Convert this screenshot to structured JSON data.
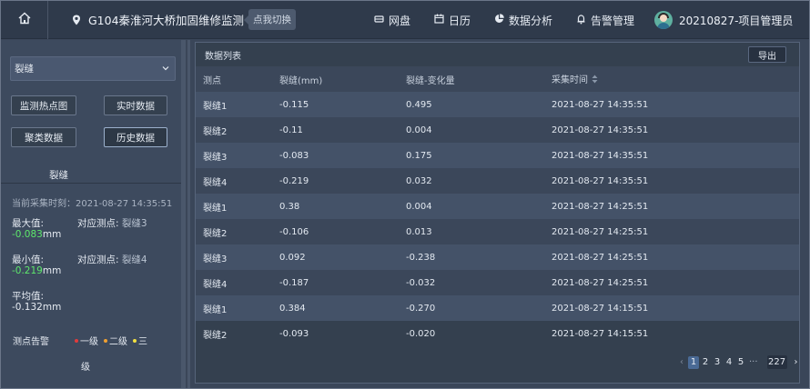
{
  "header": {
    "project_name": "G104秦淮河大桥加固维修监测",
    "switch_label": "点我切换",
    "nav": [
      {
        "label": "网盘",
        "icon": "cloud-drive-icon"
      },
      {
        "label": "日历",
        "icon": "calendar-icon"
      },
      {
        "label": "数据分析",
        "icon": "pie-chart-icon"
      },
      {
        "label": "告警管理",
        "icon": "bell-icon"
      }
    ],
    "user_name": "20210827-项目管理员"
  },
  "left": {
    "select_value": "裂缝",
    "buttons": {
      "heatmap": "监测热点图",
      "realtime": "实时数据",
      "aggregate": "聚类数据",
      "history": "历史数据"
    },
    "section_title": "裂缝",
    "current_time": "当前采集时刻：2021-08-27 14:35:51",
    "max_label": "最大值:",
    "max_value": "-0.083",
    "max_unit": "mm",
    "max_point_label": "对应测点:",
    "max_point": "裂缝3",
    "min_label": "最小值:",
    "min_value": "-0.219",
    "min_unit": "mm",
    "min_point_label": "对应测点:",
    "min_point": "裂缝4",
    "avg_label": "平均值:",
    "avg_value": "-0.132mm",
    "alarm_label": "测点告警",
    "legend": [
      {
        "label": "一级",
        "color": "#e23b3b"
      },
      {
        "label": "二级",
        "color": "#f0a030"
      },
      {
        "label": "三",
        "color": "#f2e040"
      }
    ],
    "legend_tail": "级"
  },
  "main": {
    "title": "数据列表",
    "export_label": "导出",
    "columns": [
      "测点",
      "裂缝(mm)",
      "裂缝-变化量",
      "采集时间"
    ],
    "rows": [
      [
        "裂缝1",
        "-0.115",
        "0.495",
        "2021-08-27 14:35:51"
      ],
      [
        "裂缝2",
        "-0.11",
        "0.004",
        "2021-08-27 14:35:51"
      ],
      [
        "裂缝3",
        "-0.083",
        "0.175",
        "2021-08-27 14:35:51"
      ],
      [
        "裂缝4",
        "-0.219",
        "0.032",
        "2021-08-27 14:35:51"
      ],
      [
        "裂缝1",
        "0.38",
        "0.004",
        "2021-08-27 14:25:51"
      ],
      [
        "裂缝2",
        "-0.106",
        "0.013",
        "2021-08-27 14:25:51"
      ],
      [
        "裂缝3",
        "0.092",
        "-0.238",
        "2021-08-27 14:25:51"
      ],
      [
        "裂缝4",
        "-0.187",
        "-0.032",
        "2021-08-27 14:25:51"
      ],
      [
        "裂缝1",
        "0.384",
        "-0.270",
        "2021-08-27 14:15:51"
      ],
      [
        "裂缝2",
        "-0.093",
        "-0.020",
        "2021-08-27 14:15:51"
      ]
    ],
    "pagination": {
      "prev": "‹",
      "pages": [
        "1",
        "2",
        "3",
        "4",
        "5"
      ],
      "current": "1",
      "ellipsis": "···",
      "total": "227",
      "next": "›"
    }
  },
  "colors": {
    "accent_green": "#5ee86c",
    "header_bg": "#2f3a4b",
    "page_current": "#4a6a95"
  }
}
